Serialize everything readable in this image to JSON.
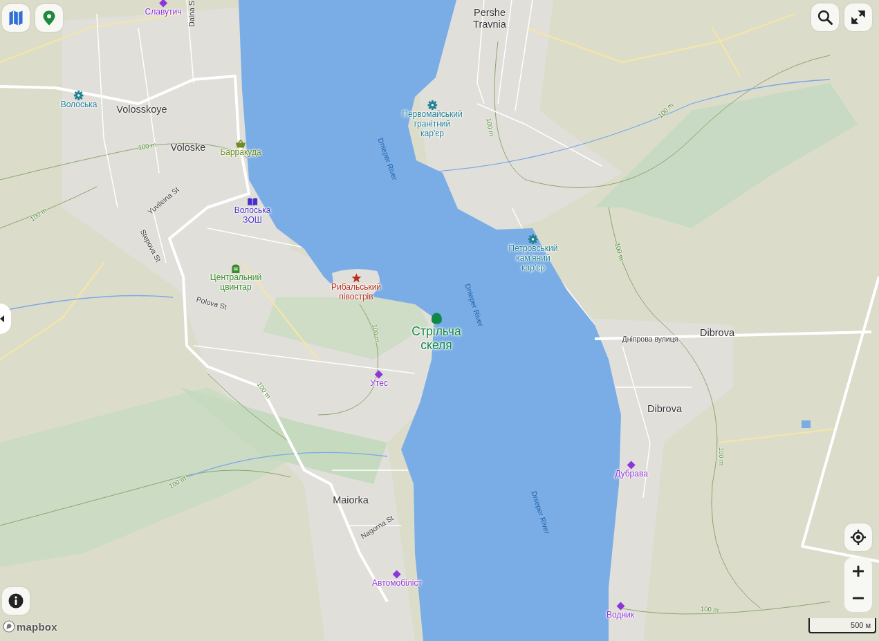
{
  "map": {
    "labels": [
      {
        "kind": "place",
        "lines": [
          "Volosskoye"
        ]
      },
      {
        "kind": "place",
        "lines": [
          "Voloske"
        ]
      },
      {
        "kind": "place",
        "lines": [
          "Pershe",
          "Travnia"
        ]
      },
      {
        "kind": "place",
        "lines": [
          "Maiorka"
        ]
      },
      {
        "kind": "place",
        "lines": [
          "Dibrova"
        ]
      },
      {
        "kind": "place",
        "lines": [
          "Dibrova"
        ]
      },
      {
        "kind": "street",
        "lines": [
          "Dalna S"
        ]
      },
      {
        "kind": "street",
        "lines": [
          "Yuvileina St"
        ]
      },
      {
        "kind": "street",
        "lines": [
          "Stepova St"
        ]
      },
      {
        "kind": "street",
        "lines": [
          "Polova St"
        ]
      },
      {
        "kind": "street",
        "lines": [
          "Nagorna St"
        ]
      },
      {
        "kind": "street",
        "lines": [
          "Дніпрова вулиця"
        ]
      },
      {
        "kind": "water",
        "lines": [
          "Dnieper River"
        ]
      },
      {
        "kind": "water",
        "lines": [
          "Dnieper River"
        ]
      },
      {
        "kind": "water",
        "lines": [
          "Dnieper River"
        ]
      },
      {
        "kind": "contour",
        "lines": [
          "100 m"
        ]
      },
      {
        "kind": "contour",
        "lines": [
          "100 m"
        ]
      },
      {
        "kind": "contour",
        "lines": [
          "100 m"
        ]
      },
      {
        "kind": "contour",
        "lines": [
          "100 m"
        ]
      },
      {
        "kind": "contour",
        "lines": [
          "100 m"
        ]
      },
      {
        "kind": "contour",
        "lines": [
          "100 m"
        ]
      },
      {
        "kind": "contour",
        "lines": [
          "100 m"
        ]
      },
      {
        "kind": "contour",
        "lines": [
          "100 m"
        ]
      },
      {
        "kind": "contour",
        "lines": [
          "100 m"
        ]
      },
      {
        "kind": "contour",
        "lines": [
          "100 m"
        ]
      }
    ],
    "pois": [
      {
        "kind": "diamond",
        "color": "#8e35d6",
        "lines": [
          "Славутич"
        ]
      },
      {
        "kind": "gear",
        "color": "#1f7f93",
        "lines": [
          "Волоська"
        ]
      },
      {
        "kind": "basket",
        "color": "#6b8e1f",
        "lines": [
          "Барракуда"
        ]
      },
      {
        "kind": "book",
        "color": "#4b2fc9",
        "lines": [
          "Волоська",
          "ЗОШ"
        ]
      },
      {
        "kind": "grave",
        "color": "#3b8a2a",
        "lines": [
          "Центральний",
          "цвинтар"
        ]
      },
      {
        "kind": "star",
        "color": "#b5301b",
        "lines": [
          "Рибальський",
          "півострів"
        ]
      },
      {
        "kind": "blob",
        "color": "#12874a",
        "lines": [
          "Стрільча",
          "скеля"
        ]
      },
      {
        "kind": "diamond",
        "color": "#8e35d6",
        "lines": [
          "Утес"
        ]
      },
      {
        "kind": "gear",
        "color": "#1f7f93",
        "lines": [
          "Первомайський",
          "гранітний",
          "кар'єр"
        ]
      },
      {
        "kind": "gear",
        "color": "#1f7f93",
        "lines": [
          "Петровський",
          "кам'яний",
          "кар'єр"
        ]
      },
      {
        "kind": "diamond",
        "color": "#8e35d6",
        "lines": [
          "Дубрава"
        ]
      },
      {
        "kind": "diamond",
        "color": "#8e35d6",
        "lines": [
          "Автомобіліст"
        ]
      },
      {
        "kind": "diamond",
        "color": "#8e35d6",
        "lines": [
          "Водник"
        ]
      }
    ]
  },
  "scale": {
    "label": "500 м"
  },
  "attribution": {
    "text": "mapbox"
  }
}
